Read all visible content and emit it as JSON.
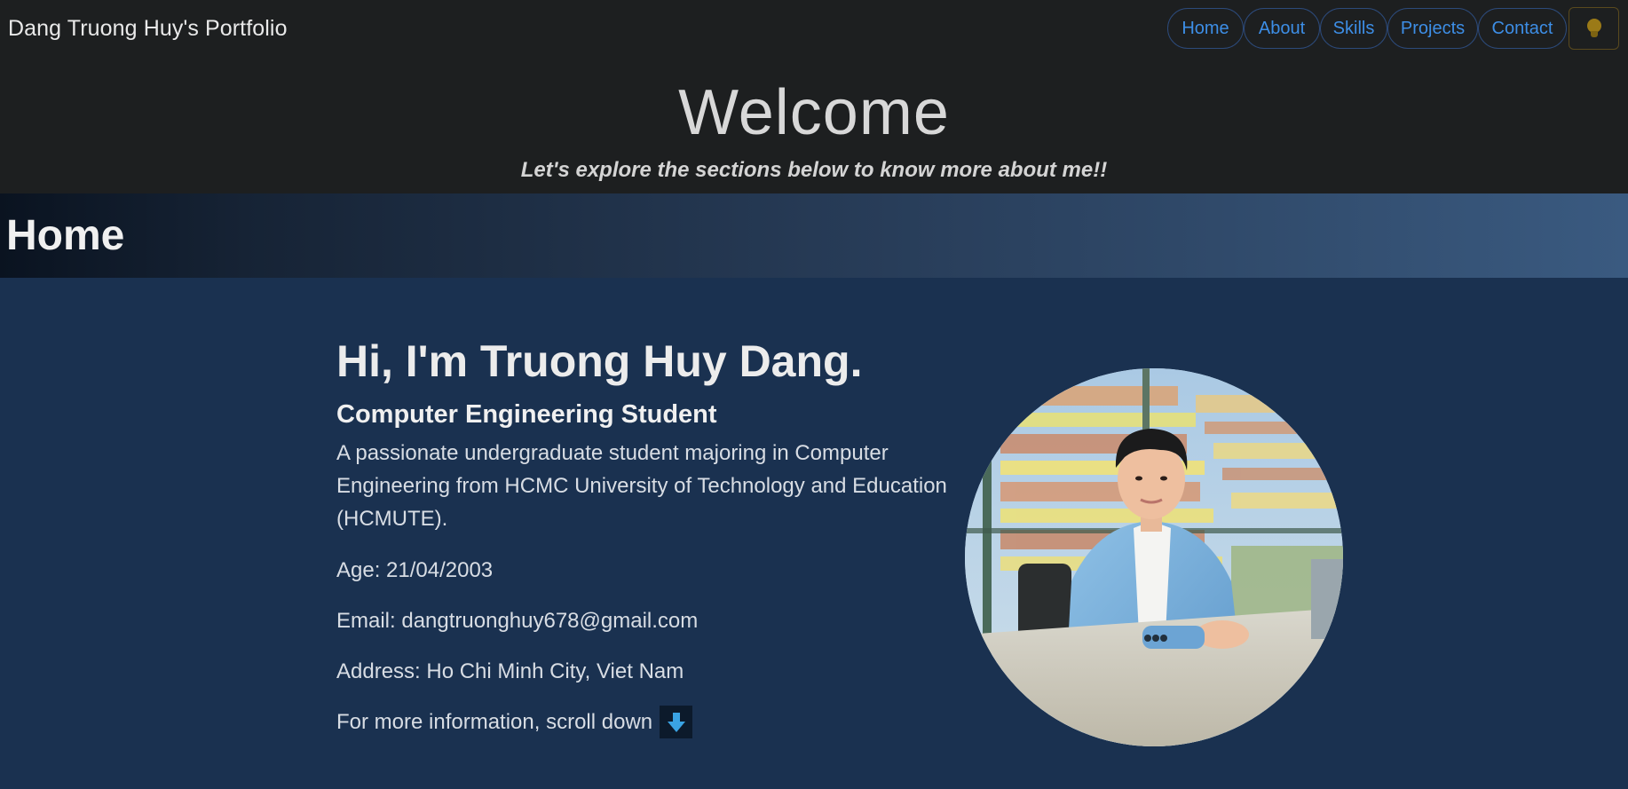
{
  "header": {
    "brand": "Dang Truong Huy's Portfolio",
    "nav": [
      "Home",
      "About",
      "Skills",
      "Projects",
      "Contact"
    ],
    "theme_toggle_icon": "lightbulb-icon",
    "welcome": "Welcome",
    "tagline": "Let's explore the sections below to know more about me!!"
  },
  "section": {
    "title": "Home"
  },
  "intro": {
    "greeting": "Hi, I'm Truong Huy Dang.",
    "role": "Computer Engineering Student",
    "description": "A passionate undergraduate student majoring in Computer Engineering from HCMC University of Technology and Education (HCMUTE).",
    "age": "Age: 21/04/2003",
    "email": "Email: dangtruonghuy678@gmail.com",
    "address": "Address: Ho Chi Minh City, Viet Nam",
    "scroll_text": "For more information, scroll down",
    "scroll_icon": "arrow-down-icon"
  },
  "colors": {
    "header_bg": "#1d1f20",
    "page_bg": "#1a3150",
    "nav_link": "#3d8ee6",
    "scroll_arrow": "#3aa3e3"
  }
}
